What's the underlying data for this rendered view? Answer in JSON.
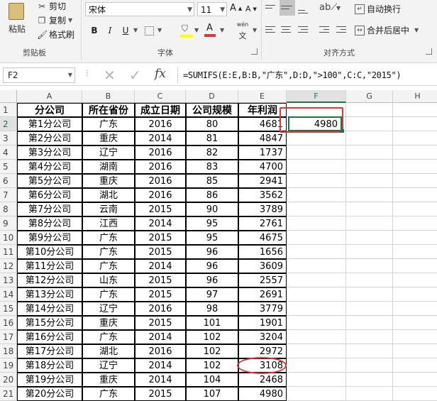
{
  "ribbon": {
    "clipboard": {
      "cut": "剪切",
      "paste": "粘贴",
      "copy": "复制",
      "format_painter": "格式刷",
      "group": "剪贴板"
    },
    "font": {
      "name": "宋体",
      "size": "11",
      "group": "字体",
      "bold": "B",
      "italic": "I",
      "underline": "U",
      "phonetic": "wén"
    },
    "alignment": {
      "wrap_text": "自动换行",
      "merge_center": "合并后居中",
      "group": "对齐方式"
    }
  },
  "formula_bar": {
    "name_box": "F2",
    "fx": "fx",
    "formula": "=SUMIFS(E:E,B:B,\"广东\",D:D,\">100\",C:C,\"2015\")"
  },
  "columns": [
    "A",
    "B",
    "C",
    "D",
    "E",
    "F",
    "G",
    "H"
  ],
  "selected_column": "F",
  "selected_row": "2",
  "headers": [
    "分公司",
    "所在省份",
    "成立日期",
    "公司规模",
    "年利润"
  ],
  "rows": [
    [
      "第1分公司",
      "广东",
      "2016",
      "80",
      "4681"
    ],
    [
      "第2分公司",
      "重庆",
      "2014",
      "81",
      "4847"
    ],
    [
      "第3分公司",
      "辽宁",
      "2016",
      "82",
      "1737"
    ],
    [
      "第4分公司",
      "湖南",
      "2016",
      "83",
      "4700"
    ],
    [
      "第5分公司",
      "重庆",
      "2016",
      "85",
      "2941"
    ],
    [
      "第6分公司",
      "湖北",
      "2016",
      "86",
      "3562"
    ],
    [
      "第7分公司",
      "云南",
      "2015",
      "90",
      "3789"
    ],
    [
      "第8分公司",
      "江西",
      "2014",
      "95",
      "2761"
    ],
    [
      "第9分公司",
      "广东",
      "2015",
      "95",
      "4675"
    ],
    [
      "第10分公司",
      "广东",
      "2015",
      "96",
      "1656"
    ],
    [
      "第11分公司",
      "广东",
      "2014",
      "96",
      "3609"
    ],
    [
      "第12分公司",
      "山东",
      "2015",
      "96",
      "2557"
    ],
    [
      "第13分公司",
      "广东",
      "2015",
      "97",
      "2691"
    ],
    [
      "第14分公司",
      "辽宁",
      "2016",
      "98",
      "3779"
    ],
    [
      "第15分公司",
      "重庆",
      "2015",
      "101",
      "1901"
    ],
    [
      "第16分公司",
      "广东",
      "2014",
      "102",
      "3204"
    ],
    [
      "第17分公司",
      "湖北",
      "2016",
      "102",
      "2972"
    ],
    [
      "第18分公司",
      "辽宁",
      "2014",
      "102",
      "3108"
    ],
    [
      "第19分公司",
      "重庆",
      "2014",
      "104",
      "2468"
    ],
    [
      "第20分公司",
      "广东",
      "2015",
      "107",
      "4980"
    ]
  ],
  "result_value": "4980",
  "colors": {
    "selection": "#217346",
    "highlight_red": "#e0353d"
  }
}
